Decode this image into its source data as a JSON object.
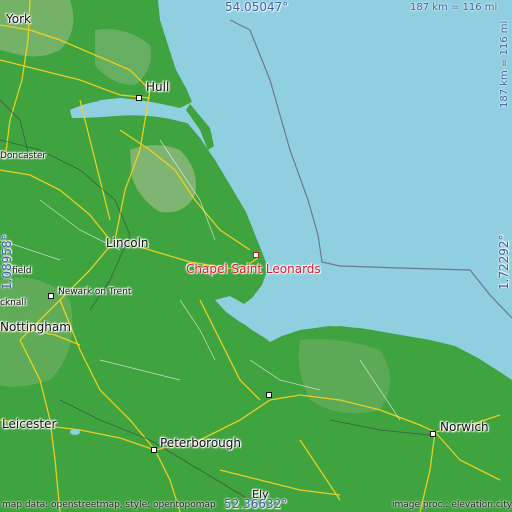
{
  "map": {
    "target": {
      "name": "Chapel Saint Leonards"
    },
    "coords": {
      "north": "54.05047°",
      "south": "52.36632°",
      "west": "1.08958°",
      "east": "1.72292°"
    },
    "scale_top": "187 km = 116 mi",
    "scale_right": "187 km = 116 mi",
    "attribution_left": "map data: openstreetmap, style: opentopomap",
    "attribution_right": "image proc.: elevation.city",
    "cities": {
      "york": "York",
      "hull": "Hull",
      "doncaster": "Doncaster",
      "lincoln": "Lincoln",
      "newark": "Newark on Trent",
      "nottingham": "Nottingham",
      "field": "field",
      "cknall": "cknall",
      "leicester": "Leicester",
      "peterborough": "Peterborough",
      "norwich": "Norwich",
      "ely": "Ely"
    },
    "colors": {
      "sea": "#8fcfe0",
      "land": "#3fa33f",
      "highland": "#8bb87a",
      "target": "#e0182c",
      "coord_text": "#3b5ea6",
      "roads": "#f2d21e"
    }
  }
}
